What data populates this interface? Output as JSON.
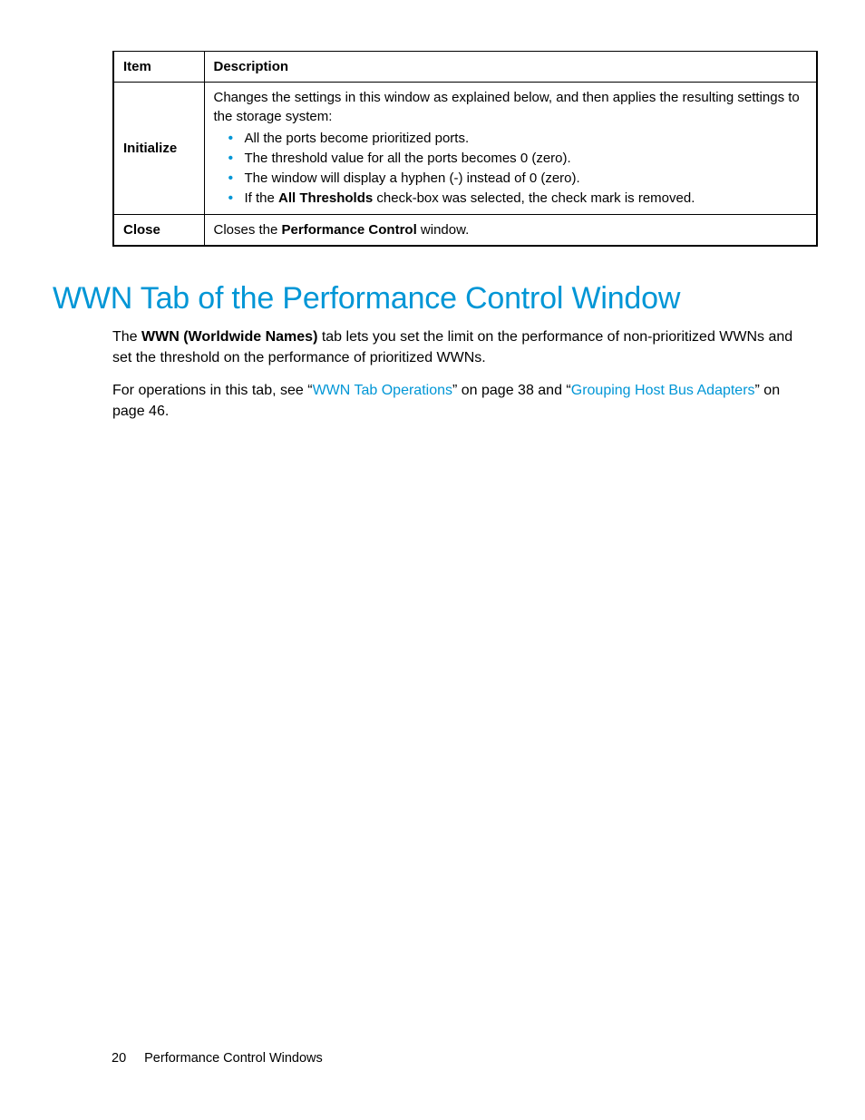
{
  "table": {
    "headers": {
      "item": "Item",
      "description": "Description"
    },
    "rows": [
      {
        "item": "Initialize",
        "intro": "Changes the settings in this window as explained below, and then applies the resulting settings to the storage system:",
        "bullets": [
          {
            "text": "All the ports become prioritized ports."
          },
          {
            "text": "The threshold value for all the ports becomes 0 (zero)."
          },
          {
            "text": "The window will display a hyphen (-) instead of 0 (zero)."
          },
          {
            "pre": "If the ",
            "bold": "All Thresholds",
            "post": " check-box was selected, the check mark is removed."
          }
        ]
      },
      {
        "item": "Close",
        "pre": "Closes the ",
        "bold": "Performance Control",
        "post": " window."
      }
    ]
  },
  "heading": "WWN Tab of the Performance Control Window",
  "para1": {
    "pre": "The ",
    "bold": "WWN (Worldwide Names)",
    "post": " tab lets you set the limit on the performance of non-prioritized WWNs and set the threshold on the performance of prioritized WWNs."
  },
  "para2": {
    "pre": "For operations in this tab, see “",
    "link1": "WWN Tab Operations",
    "mid1": "” on page 38 and “",
    "link2": "Grouping Host Bus Adapters",
    "post": "” on page 46."
  },
  "footer": {
    "page": "20",
    "title": "Performance Control Windows"
  }
}
